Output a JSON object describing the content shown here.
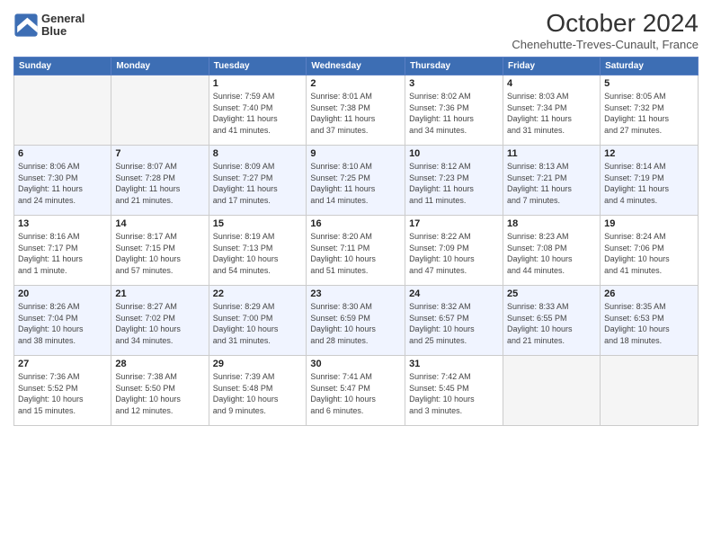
{
  "header": {
    "logo_line1": "General",
    "logo_line2": "Blue",
    "title": "October 2024",
    "location": "Chenehutte-Treves-Cunault, France"
  },
  "weekdays": [
    "Sunday",
    "Monday",
    "Tuesday",
    "Wednesday",
    "Thursday",
    "Friday",
    "Saturday"
  ],
  "weeks": [
    [
      {
        "day": "",
        "info": ""
      },
      {
        "day": "",
        "info": ""
      },
      {
        "day": "1",
        "info": "Sunrise: 7:59 AM\nSunset: 7:40 PM\nDaylight: 11 hours\nand 41 minutes."
      },
      {
        "day": "2",
        "info": "Sunrise: 8:01 AM\nSunset: 7:38 PM\nDaylight: 11 hours\nand 37 minutes."
      },
      {
        "day": "3",
        "info": "Sunrise: 8:02 AM\nSunset: 7:36 PM\nDaylight: 11 hours\nand 34 minutes."
      },
      {
        "day": "4",
        "info": "Sunrise: 8:03 AM\nSunset: 7:34 PM\nDaylight: 11 hours\nand 31 minutes."
      },
      {
        "day": "5",
        "info": "Sunrise: 8:05 AM\nSunset: 7:32 PM\nDaylight: 11 hours\nand 27 minutes."
      }
    ],
    [
      {
        "day": "6",
        "info": "Sunrise: 8:06 AM\nSunset: 7:30 PM\nDaylight: 11 hours\nand 24 minutes."
      },
      {
        "day": "7",
        "info": "Sunrise: 8:07 AM\nSunset: 7:28 PM\nDaylight: 11 hours\nand 21 minutes."
      },
      {
        "day": "8",
        "info": "Sunrise: 8:09 AM\nSunset: 7:27 PM\nDaylight: 11 hours\nand 17 minutes."
      },
      {
        "day": "9",
        "info": "Sunrise: 8:10 AM\nSunset: 7:25 PM\nDaylight: 11 hours\nand 14 minutes."
      },
      {
        "day": "10",
        "info": "Sunrise: 8:12 AM\nSunset: 7:23 PM\nDaylight: 11 hours\nand 11 minutes."
      },
      {
        "day": "11",
        "info": "Sunrise: 8:13 AM\nSunset: 7:21 PM\nDaylight: 11 hours\nand 7 minutes."
      },
      {
        "day": "12",
        "info": "Sunrise: 8:14 AM\nSunset: 7:19 PM\nDaylight: 11 hours\nand 4 minutes."
      }
    ],
    [
      {
        "day": "13",
        "info": "Sunrise: 8:16 AM\nSunset: 7:17 PM\nDaylight: 11 hours\nand 1 minute."
      },
      {
        "day": "14",
        "info": "Sunrise: 8:17 AM\nSunset: 7:15 PM\nDaylight: 10 hours\nand 57 minutes."
      },
      {
        "day": "15",
        "info": "Sunrise: 8:19 AM\nSunset: 7:13 PM\nDaylight: 10 hours\nand 54 minutes."
      },
      {
        "day": "16",
        "info": "Sunrise: 8:20 AM\nSunset: 7:11 PM\nDaylight: 10 hours\nand 51 minutes."
      },
      {
        "day": "17",
        "info": "Sunrise: 8:22 AM\nSunset: 7:09 PM\nDaylight: 10 hours\nand 47 minutes."
      },
      {
        "day": "18",
        "info": "Sunrise: 8:23 AM\nSunset: 7:08 PM\nDaylight: 10 hours\nand 44 minutes."
      },
      {
        "day": "19",
        "info": "Sunrise: 8:24 AM\nSunset: 7:06 PM\nDaylight: 10 hours\nand 41 minutes."
      }
    ],
    [
      {
        "day": "20",
        "info": "Sunrise: 8:26 AM\nSunset: 7:04 PM\nDaylight: 10 hours\nand 38 minutes."
      },
      {
        "day": "21",
        "info": "Sunrise: 8:27 AM\nSunset: 7:02 PM\nDaylight: 10 hours\nand 34 minutes."
      },
      {
        "day": "22",
        "info": "Sunrise: 8:29 AM\nSunset: 7:00 PM\nDaylight: 10 hours\nand 31 minutes."
      },
      {
        "day": "23",
        "info": "Sunrise: 8:30 AM\nSunset: 6:59 PM\nDaylight: 10 hours\nand 28 minutes."
      },
      {
        "day": "24",
        "info": "Sunrise: 8:32 AM\nSunset: 6:57 PM\nDaylight: 10 hours\nand 25 minutes."
      },
      {
        "day": "25",
        "info": "Sunrise: 8:33 AM\nSunset: 6:55 PM\nDaylight: 10 hours\nand 21 minutes."
      },
      {
        "day": "26",
        "info": "Sunrise: 8:35 AM\nSunset: 6:53 PM\nDaylight: 10 hours\nand 18 minutes."
      }
    ],
    [
      {
        "day": "27",
        "info": "Sunrise: 7:36 AM\nSunset: 5:52 PM\nDaylight: 10 hours\nand 15 minutes."
      },
      {
        "day": "28",
        "info": "Sunrise: 7:38 AM\nSunset: 5:50 PM\nDaylight: 10 hours\nand 12 minutes."
      },
      {
        "day": "29",
        "info": "Sunrise: 7:39 AM\nSunset: 5:48 PM\nDaylight: 10 hours\nand 9 minutes."
      },
      {
        "day": "30",
        "info": "Sunrise: 7:41 AM\nSunset: 5:47 PM\nDaylight: 10 hours\nand 6 minutes."
      },
      {
        "day": "31",
        "info": "Sunrise: 7:42 AM\nSunset: 5:45 PM\nDaylight: 10 hours\nand 3 minutes."
      },
      {
        "day": "",
        "info": ""
      },
      {
        "day": "",
        "info": ""
      }
    ]
  ]
}
